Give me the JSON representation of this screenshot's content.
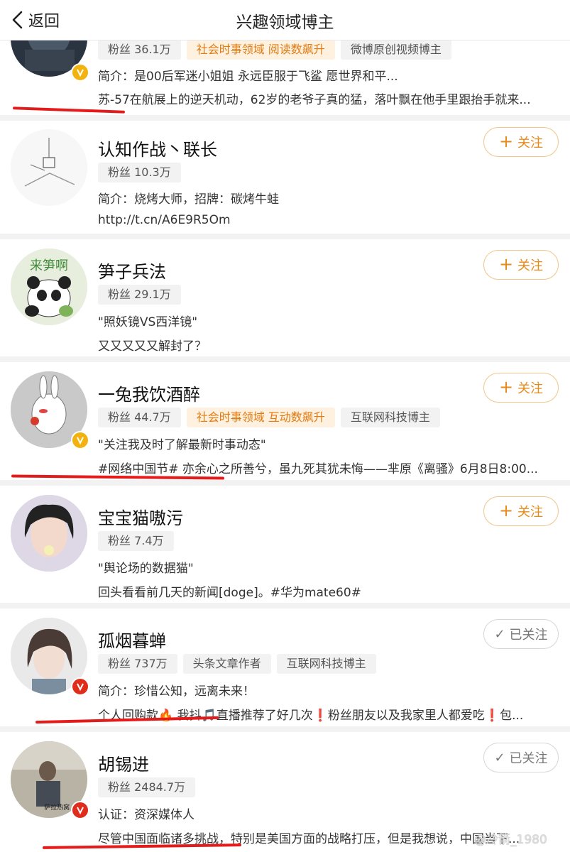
{
  "nav": {
    "back_label": "返回",
    "title": "兴趣领域博主"
  },
  "follow_label": "关注",
  "followed_label": "已关注",
  "colors": {
    "accent": "#e78a1a",
    "underline": "#e51b1b",
    "verified_gold": "#f2b311",
    "verified_red": "#e02d1b"
  },
  "cards": [
    {
      "name": "",
      "tags": [
        "粉丝 36.1万",
        "社会时事领域 阅读数飙升",
        "微博原创视频博主"
      ],
      "lines": [
        "简介：是00后军迷小姐姐 永远臣服于飞鲨 愿世界和平...",
        "苏-57在航展上的逆天机动，62岁的老爷子真的猛，落叶飘在他手里跟抬手就来..."
      ]
    },
    {
      "name": "认知作战丶联长",
      "tags": [
        "粉丝 10.3万"
      ],
      "lines": [
        "简介：烧烤大师，招牌：碳烤牛蛙",
        "http://t.cn/A6E9R5Om"
      ],
      "follow": "follow"
    },
    {
      "name": "笋子兵法",
      "tags": [
        "粉丝 29.1万"
      ],
      "lines": [
        "\"照妖镜VS西洋镜\"",
        "又又又又又解封了？"
      ],
      "follow": "follow",
      "avatar_text": "来笋啊"
    },
    {
      "name": "一兔我饮酒醉",
      "tags": [
        "粉丝 44.7万",
        "社会时事领域 互动数飙升",
        "互联网科技博主"
      ],
      "lines": [
        "\"关注我及时了解最新时事动态\"",
        "#网络中国节# 亦余心之所善兮，虽九死其犹未悔——芈原《离骚》6月8日8:00..."
      ],
      "follow": "follow"
    },
    {
      "name": "宝宝猫嗷污",
      "tags": [
        "粉丝 7.4万"
      ],
      "lines": [
        "\"舆论场的数据猫\"",
        "回头看看前几天的新闻[doge]。#华为mate60#"
      ],
      "follow": "follow"
    },
    {
      "name": "孤烟暮蝉",
      "tags": [
        "粉丝 737万",
        "头条文章作者",
        "互联网科技博主"
      ],
      "lines": [
        "简介：珍惜公知，远离未来！",
        "个人回购款🔥 我抖🎵直播推荐了好几次❗粉丝朋友以及我家里人都爱吃❗包..."
      ],
      "follow": "followed"
    },
    {
      "name": "胡锡进",
      "tags": [
        "粉丝 2484.7万"
      ],
      "lines": [
        "认证：资深媒体人",
        "尽管中国面临诸多挑战，特别是美国方面的战略打压，但是我想说，中国当下..."
      ],
      "follow": "followed",
      "avatar_text": "萨拉热窝 1961"
    }
  ],
  "watermark": "@冷箭_1980"
}
